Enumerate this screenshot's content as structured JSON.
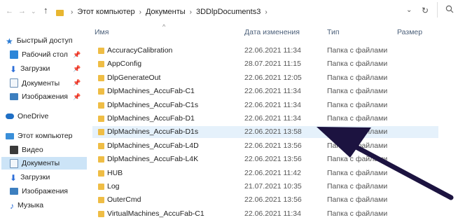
{
  "address": {
    "crumbs": [
      "Этот компьютер",
      "Документы",
      "3DDlpDocuments3"
    ],
    "refresh_icon": "refresh-icon",
    "search_icon": "search-icon"
  },
  "columns": {
    "name": "Имя",
    "date": "Дата изменения",
    "type": "Тип",
    "size": "Размер"
  },
  "sidebar": {
    "items": [
      {
        "label": "Быстрый доступ",
        "icon": "star-icon"
      },
      {
        "label": "Рабочий стол",
        "icon": "desktop-icon"
      },
      {
        "label": "Загрузки",
        "icon": "download-icon"
      },
      {
        "label": "Документы",
        "icon": "documents-icon"
      },
      {
        "label": "Изображения",
        "icon": "pictures-icon"
      },
      {
        "label": "OneDrive",
        "icon": "cloud-icon"
      },
      {
        "label": "Этот компьютер",
        "icon": "computer-icon"
      },
      {
        "label": "Видео",
        "icon": "video-icon"
      },
      {
        "label": "Документы",
        "icon": "documents-icon"
      },
      {
        "label": "Загрузки",
        "icon": "download-icon"
      },
      {
        "label": "Изображения",
        "icon": "pictures-icon"
      },
      {
        "label": "Музыка",
        "icon": "music-icon"
      }
    ]
  },
  "files": [
    {
      "name": "AccuracyCalibration",
      "date": "22.06.2021 11:34",
      "type": "Папка с файлами"
    },
    {
      "name": "AppConfig",
      "date": "28.07.2021 11:15",
      "type": "Папка с файлами"
    },
    {
      "name": "DlpGenerateOut",
      "date": "22.06.2021 12:05",
      "type": "Папка с файлами"
    },
    {
      "name": "DlpMachines_AccuFab-C1",
      "date": "22.06.2021 11:34",
      "type": "Папка с файлами"
    },
    {
      "name": "DlpMachines_AccuFab-C1s",
      "date": "22.06.2021 11:34",
      "type": "Папка с файлами"
    },
    {
      "name": "DlpMachines_AccuFab-D1",
      "date": "22.06.2021 11:34",
      "type": "Папка с файлами"
    },
    {
      "name": "DlpMachines_AccuFab-D1s",
      "date": "22.06.2021 13:58",
      "type": "Папка с файлами"
    },
    {
      "name": "DlpMachines_AccuFab-L4D",
      "date": "22.06.2021 13:56",
      "type": "Папка с файлами"
    },
    {
      "name": "DlpMachines_AccuFab-L4K",
      "date": "22.06.2021 13:56",
      "type": "Папка с файлами"
    },
    {
      "name": "HUB",
      "date": "22.06.2021 11:42",
      "type": "Папка с файлами"
    },
    {
      "name": "Log",
      "date": "21.07.2021 10:35",
      "type": "Папка с файлами"
    },
    {
      "name": "OuterCmd",
      "date": "22.06.2021 13:56",
      "type": "Папка с файлами"
    },
    {
      "name": "VirtualMachines_AccuFab-C1",
      "date": "22.06.2021 11:34",
      "type": "Папка с файлами"
    }
  ],
  "selected_file": "DlpMachines_AccuFab-D1s",
  "colors": {
    "folder": "#efbd45",
    "selection": "#cce4f7",
    "hover_row": "#e5f1fb",
    "arrow": "#1c1340"
  }
}
